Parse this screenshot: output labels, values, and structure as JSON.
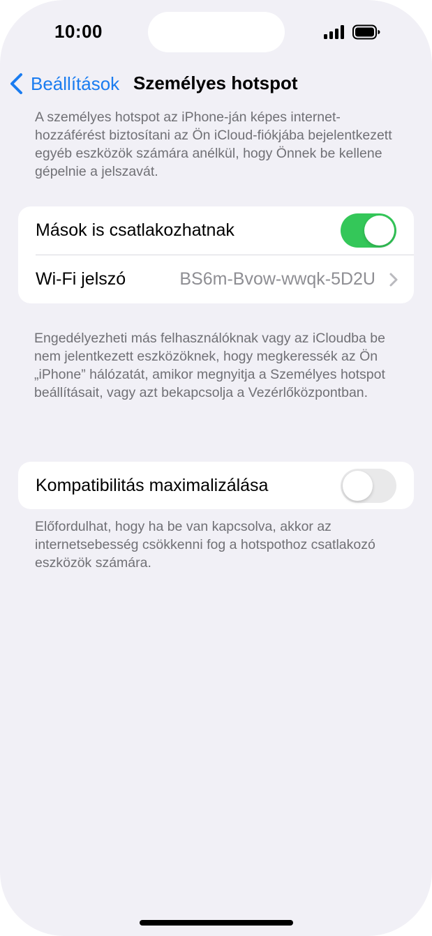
{
  "status_bar": {
    "time": "10:00"
  },
  "nav": {
    "back_label": "Beállítások",
    "title": "Személyes hotspot"
  },
  "descriptions": {
    "top": "A személyes hotspot az iPhone-ján képes internet-hozzáférést biztosítani az Ön iCloud-fiókjába bejelentkezett egyéb eszközök számára anélkül, hogy Önnek be kellene gépelnie a jelszavát.",
    "middle": "Engedélyezheti más felhasználóknak vagy az iCloudba be nem jelentkezett eszközöknek, hogy megkeressék az Ön „iPhone” hálózatát, amikor megnyitja a Személyes hotspot beállításait, vagy azt bekapcsolja a Vezérlőközpontban.",
    "bottom": "Előfordulhat, hogy ha be van kapcsolva, akkor az internetsebesség csökkenni fog a hotspothoz csatlakozó eszközök számára."
  },
  "settings": {
    "allow_others": {
      "label": "Mások is csatlakozhatnak",
      "enabled": true
    },
    "wifi_password": {
      "label": "Wi-Fi jelszó",
      "value": "BS6m-Bvow-wwqk-5D2U"
    },
    "maximize_compatibility": {
      "label": "Kompatibilitás maximalizálása",
      "enabled": false
    }
  },
  "colors": {
    "accent": "#1a7cf0",
    "toggle_on": "#34c759",
    "toggle_off": "#e9e9ea",
    "background": "#f1f0f6",
    "secondary_text": "#707075"
  },
  "icons": {
    "back": "chevron-left-icon",
    "row_disclosure": "chevron-right-icon",
    "signal": "cellular-signal-icon",
    "battery": "battery-icon"
  }
}
